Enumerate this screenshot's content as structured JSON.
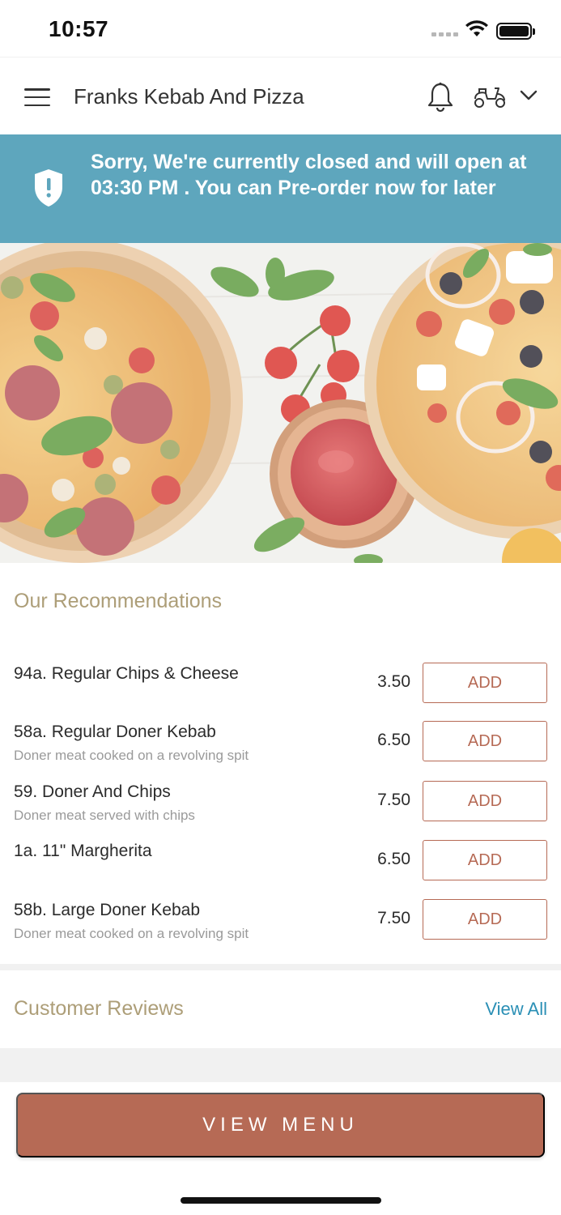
{
  "status_bar": {
    "time": "10:57"
  },
  "header": {
    "title": "Franks Kebab And Pizza",
    "icons": [
      "menu-icon",
      "bell-icon",
      "scooter-icon",
      "chevron-down-icon"
    ]
  },
  "banner": {
    "message": "Sorry, We're currently closed and will open at 03:30 PM . You can Pre-order now for later",
    "icon": "shield-alert-icon",
    "color": "#5ea6bd"
  },
  "recommendations": {
    "title": "Our Recommendations",
    "add_label": "ADD",
    "items": [
      {
        "name": "94a. Regular Chips & Cheese",
        "description": "",
        "price": "3.50"
      },
      {
        "name": "58a. Regular Doner Kebab",
        "description": "Doner meat cooked on a revolving spit",
        "price": "6.50"
      },
      {
        "name": "59. Doner And Chips",
        "description": "Doner meat served with chips",
        "price": "7.50"
      },
      {
        "name": "1a. 11\" Margherita",
        "description": "",
        "price": "6.50"
      },
      {
        "name": "58b. Large Doner Kebab",
        "description": "Doner meat cooked on a revolving spit",
        "price": "7.50"
      }
    ]
  },
  "reviews": {
    "title": "Customer Reviews",
    "view_all": "View All"
  },
  "footer": {
    "view_menu": "VIEW MENU"
  },
  "colors": {
    "accent": "#b66a55",
    "section_title": "#ad9e78",
    "link": "#2a8fb5"
  }
}
